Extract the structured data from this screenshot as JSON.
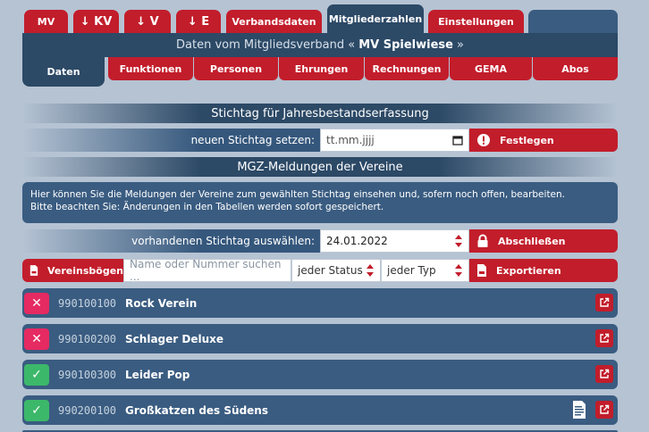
{
  "tabs": [
    {
      "label": "MV"
    },
    {
      "label": "↓ KV"
    },
    {
      "label": "↓ V"
    },
    {
      "label": "↓ E"
    },
    {
      "label": "Verbandsdaten"
    },
    {
      "label": "Mitgliederzahlen"
    },
    {
      "label": "Einstellungen"
    }
  ],
  "header": {
    "prefix": "Daten vom Mitgliedsverband «",
    "name": "MV Spielwiese",
    "suffix": "»"
  },
  "subtabs": [
    {
      "label": "Daten"
    },
    {
      "label": "Funktionen"
    },
    {
      "label": "Personen"
    },
    {
      "label": "Ehrungen"
    },
    {
      "label": "Rechnungen"
    },
    {
      "label": "GEMA"
    },
    {
      "label": "Abos"
    }
  ],
  "stichtag": {
    "section_title": "Stichtag für Jahresbestandserfassung",
    "set_label": "neuen Stichtag setzen:",
    "date_placeholder": "tt.mm.jjjj",
    "button_label": "Festlegen"
  },
  "mgz": {
    "section_title": "MGZ-Meldungen der Vereine",
    "info_line1": "Hier können Sie die Meldungen der Vereine zum gewählten Stichtag einsehen und, sofern noch offen, bearbeiten.",
    "info_line2": "Bitte beachten Sie: Änderungen in den Tabellen werden sofort gespeichert.",
    "select_label": "vorhandenen Stichtag auswählen:",
    "selected_date": "24.01.2022",
    "close_button": "Abschließen",
    "forms_button": "Vereinsbögen",
    "search_placeholder": "Name oder Nummer suchen ...",
    "status_filter": "jeder Status",
    "type_filter": "jeder Typ",
    "export_button": "Exportieren"
  },
  "vereine": [
    {
      "number": "990100100",
      "name": "Rock Verein",
      "status": "open"
    },
    {
      "number": "990100200",
      "name": "Schlager Deluxe",
      "status": "open"
    },
    {
      "number": "990100300",
      "name": "Leider Pop",
      "status": "done"
    },
    {
      "number": "990200100",
      "name": "Großkatzen des Südens",
      "status": "done"
    }
  ],
  "colors": {
    "accent_red": "#c21d2b",
    "dark_blue": "#2c4966",
    "row_blue": "#3a5c81",
    "ok_green": "#3cb86a",
    "error_pink": "#e62a62"
  }
}
